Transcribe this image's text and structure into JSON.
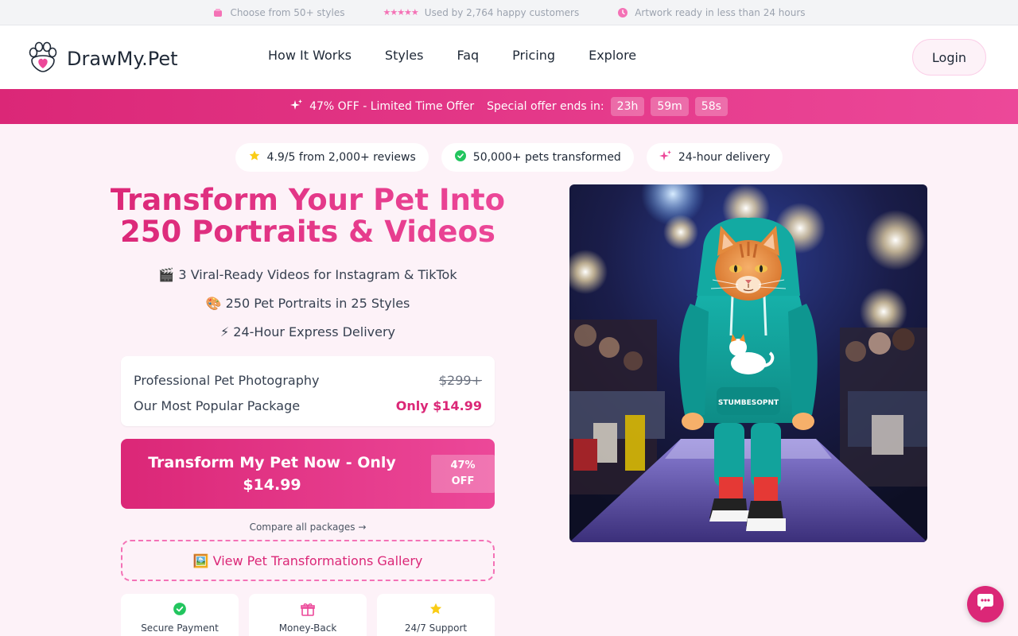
{
  "topbar": {
    "styles_text": "Choose from 50+ styles",
    "customers_text": "Used by 2,764 happy customers",
    "delivery_text": "Artwork ready in less than 24 hours",
    "stars": "★★★★★"
  },
  "nav": {
    "brand": "DrawMy.Pet",
    "links": [
      "How It Works",
      "Styles",
      "Faq",
      "Pricing",
      "Explore"
    ],
    "login": "Login"
  },
  "promo": {
    "offer": "47% OFF - Limited Time Offer",
    "ends_label": "Special offer ends in:",
    "hours": "23h",
    "minutes": "59m",
    "seconds": "58s"
  },
  "badges": {
    "rating": "4.9/5 from 2,000+ reviews",
    "pets": "50,000+ pets transformed",
    "delivery": "24-hour delivery"
  },
  "hero": {
    "title_line1": "Transform Your Pet Into",
    "title_line2": "250 Portraits & Videos",
    "features": [
      "🎬 3 Viral-Ready Videos for Instagram & TikTok",
      "🎨 250 Pet Portraits in 25 Styles",
      "⚡ 24-Hour Express Delivery"
    ]
  },
  "pricing": {
    "row1_label": "Professional Pet Photography",
    "row1_value": "$299+",
    "row2_label": "Our Most Popular Package",
    "row2_value": "Only $14.99"
  },
  "cta": {
    "line1": "Transform My Pet Now - Only",
    "line2": "$14.99",
    "off_line1": "47%",
    "off_line2": "OFF"
  },
  "compare": "Compare all packages →",
  "gallery": "🖼️ View Pet Transformations Gallery",
  "trust": [
    "Secure Payment",
    "Money-Back",
    "24/7 Support"
  ],
  "hoodie_text": "STUMBESOPNT",
  "colors": {
    "brand_pink": "#db2777",
    "accent_pink": "#ec4899",
    "background": "#fdf2f8"
  }
}
